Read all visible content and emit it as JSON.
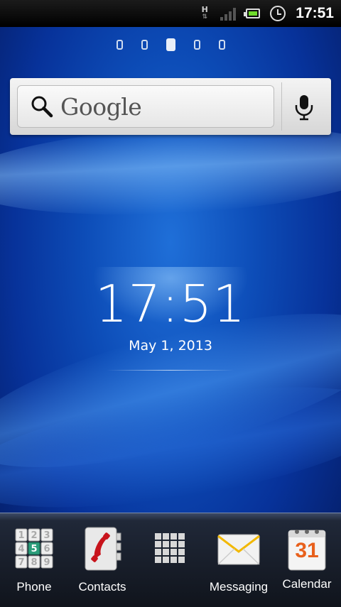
{
  "status_bar": {
    "network_type": "H",
    "time": "17:51",
    "icons": [
      "network-h-icon",
      "signal-icon",
      "battery-icon",
      "alarm-icon"
    ]
  },
  "home": {
    "page_count": 5,
    "active_page": 3
  },
  "search_widget": {
    "logo_text": "Google",
    "icons": [
      "search-icon",
      "mic-icon"
    ]
  },
  "clock_widget": {
    "time": "17:51",
    "date": "May 1, 2013"
  },
  "dock": {
    "items": [
      {
        "label": "Phone",
        "icon": "phone-keypad-icon"
      },
      {
        "label": "Contacts",
        "icon": "contacts-icon"
      },
      {
        "label": "",
        "icon": "app-drawer-icon"
      },
      {
        "label": "Messaging",
        "icon": "messaging-icon"
      },
      {
        "label": "Calendar",
        "icon": "calendar-icon"
      }
    ],
    "calendar_day": "31"
  }
}
